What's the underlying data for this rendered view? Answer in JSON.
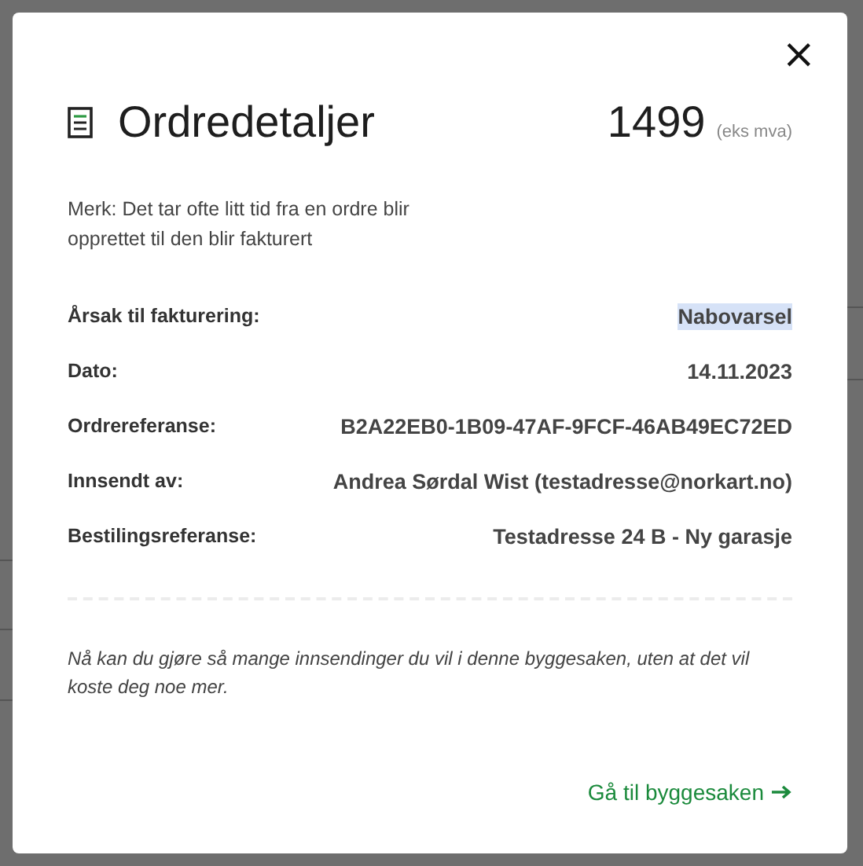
{
  "dialog": {
    "close": "×",
    "title": "Ordredetaljer",
    "price": "1499",
    "price_note": "(eks mva)",
    "note": "Merk: Det tar ofte litt tid fra en ordre blir opprettet til den blir fakturert",
    "details": [
      {
        "label": "Årsak til fakturering:",
        "value": "Nabovarsel",
        "highlighted": true
      },
      {
        "label": "Dato:",
        "value": "14.11.2023",
        "highlighted": false
      },
      {
        "label": "Ordrereferanse:",
        "value": "B2A22EB0-1B09-47AF-9FCF-46AB49EC72ED",
        "highlighted": false
      },
      {
        "label": "Innsendt av:",
        "value": "Andrea Sørdal Wist (testadresse@norkart.no)",
        "highlighted": false
      },
      {
        "label": "Bestilingsreferanse:",
        "value": "Testadresse 24 B - Ny garasje",
        "highlighted": false
      }
    ],
    "info": "Nå kan du gjøre så mange innsendinger du vil i denne byggesaken, uten at det vil koste deg noe mer.",
    "link": "Gå til byggesaken"
  }
}
